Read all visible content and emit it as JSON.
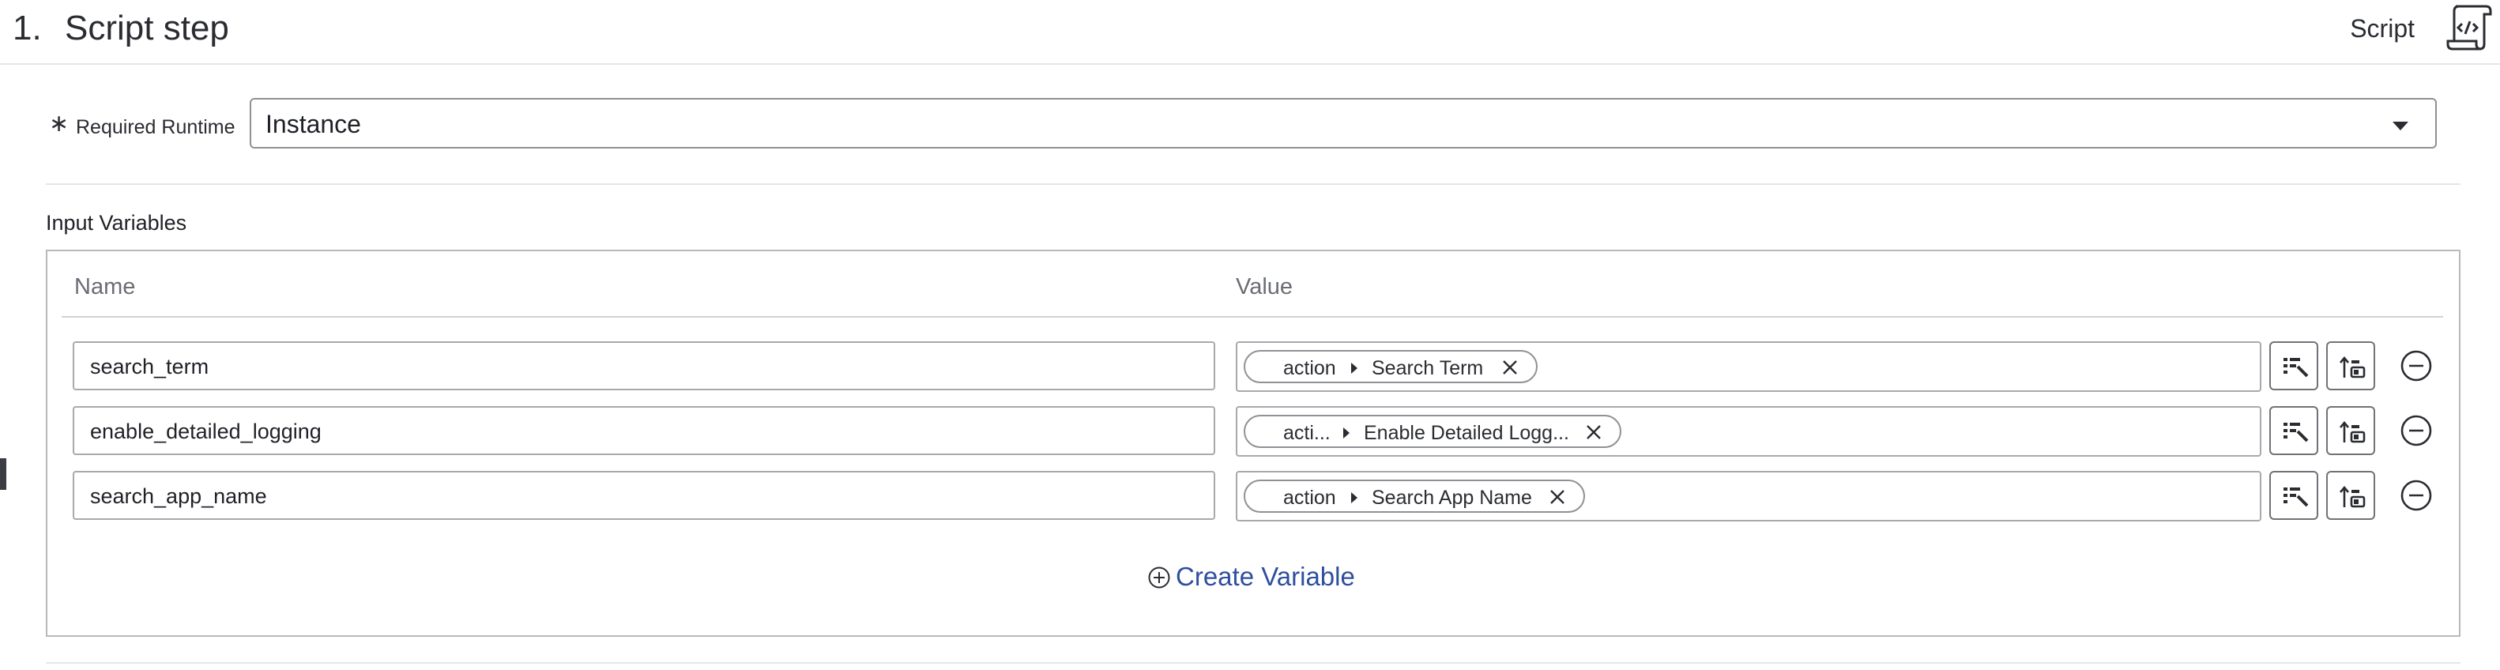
{
  "header": {
    "step_number": "1.",
    "step_title": "Script step",
    "step_type": "Script",
    "type_icon": "script-scroll-icon"
  },
  "runtime": {
    "required_marker": "∗",
    "label": "Required Runtime",
    "value": "Instance"
  },
  "input_variables": {
    "title": "Input Variables",
    "columns": {
      "name": "Name",
      "value": "Value"
    },
    "rows": [
      {
        "name": "search_term",
        "pill_source": "action",
        "pill_label": "Search Term"
      },
      {
        "name": "enable_detailed_logging",
        "pill_source": "acti...",
        "pill_label": "Enable Detailed Logg..."
      },
      {
        "name": "search_app_name",
        "pill_source": "action",
        "pill_label": "Search App Name"
      }
    ],
    "create_label": "Create Variable"
  },
  "colors": {
    "link": "#2f4e9e",
    "border": "#a7a9ad",
    "text": "#1f2126"
  }
}
